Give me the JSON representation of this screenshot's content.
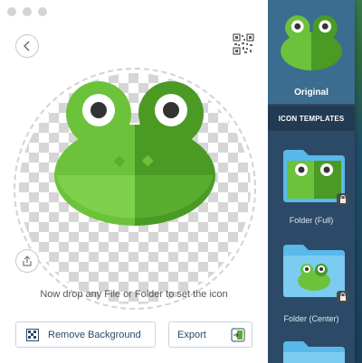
{
  "window": {
    "traffic_lights": [
      "close",
      "minimize",
      "zoom"
    ]
  },
  "main": {
    "back_icon": "chevron-left-icon",
    "qr_icon": "qr-code-icon",
    "share_icon": "share-icon",
    "hint": "Now drop any File or Folder to set the icon",
    "remove_background_label": "Remove Background",
    "export_label": "Export"
  },
  "sidebar": {
    "original_label": "Original",
    "section_title": "ICON TEMPLATES",
    "templates": [
      {
        "label": "Folder (Full)",
        "locked": true
      },
      {
        "label": "Folder (Center)",
        "locked": true
      },
      {
        "label": "",
        "locked": false
      }
    ]
  },
  "colors": {
    "frog_light": "#6cc23a",
    "frog_dark": "#4a9a24",
    "sidebar_bg": "#2c4a67",
    "original_bg": "#3a6d8f",
    "folder_blue": "#59b9ea"
  }
}
